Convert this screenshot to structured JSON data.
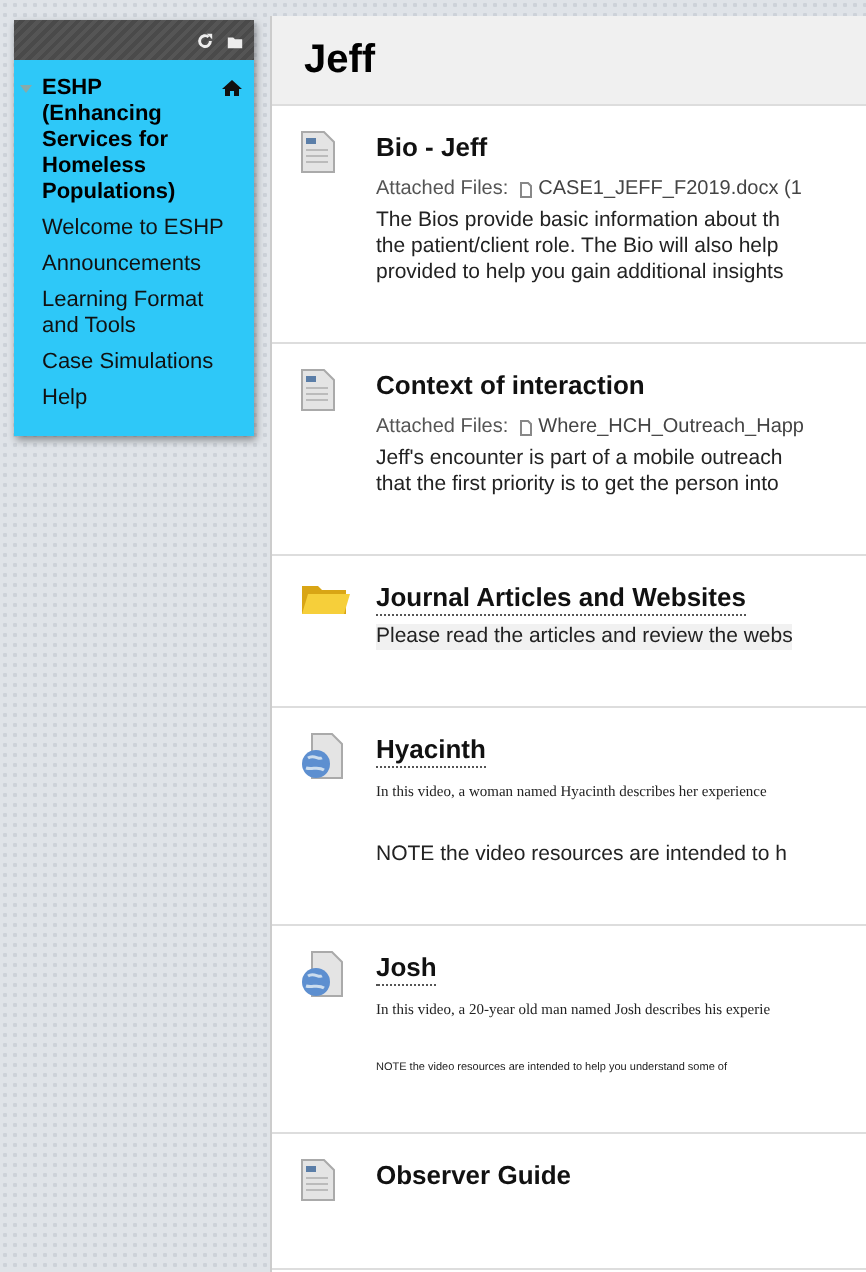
{
  "sidebar": {
    "course_title": "ESHP (Enhancing Services for Homeless Populations)",
    "expanded": true,
    "items": [
      {
        "label": "Welcome to ESHP"
      },
      {
        "label": "Announcements"
      },
      {
        "label": "Learning Format and Tools"
      },
      {
        "label": "Case Simulations"
      },
      {
        "label": "Help"
      }
    ]
  },
  "page": {
    "title": "Jeff"
  },
  "items": [
    {
      "kind": "document",
      "title": "Bio - Jeff",
      "attachment_label": "Attached Files:",
      "attachment": "CASE1_JEFF_F2019.docx (1",
      "lines": [
        {
          "kind": "paragraph",
          "text": "The Bios provide basic information about th"
        },
        {
          "kind": "paragraph",
          "text": "the patient/client role. The Bio will also help"
        },
        {
          "kind": "paragraph",
          "text": "provided to help you gain additional insights"
        }
      ]
    },
    {
      "kind": "document",
      "title": "Context of interaction",
      "attachment_label": "Attached Files:",
      "attachment": "Where_HCH_Outreach_Happ",
      "lines": [
        {
          "kind": "paragraph",
          "text": "Jeff's encounter is part of a mobile outreach"
        },
        {
          "kind": "paragraph",
          "text": "that the first priority is to get the person into"
        }
      ]
    },
    {
      "kind": "folder",
      "title": "Journal Articles and Websites",
      "lines": [
        {
          "kind": "highlighted",
          "text": "Please read the articles and review the webs"
        }
      ]
    },
    {
      "kind": "link",
      "title": "Hyacinth",
      "lines": [
        {
          "kind": "summary",
          "text": "In this video, a woman named Hyacinth describes her experience"
        },
        {
          "kind": "paragraph",
          "text": "NOTE the video resources are intended to h"
        }
      ]
    },
    {
      "kind": "link",
      "title": "Josh",
      "lines": [
        {
          "kind": "summary",
          "text": "In this video, a 20-year old man named Josh describes his experie"
        },
        {
          "kind": "fine_print",
          "text": "NOTE the video resources are intended to help you understand some of"
        }
      ]
    },
    {
      "kind": "document",
      "title": "Observer Guide"
    }
  ]
}
